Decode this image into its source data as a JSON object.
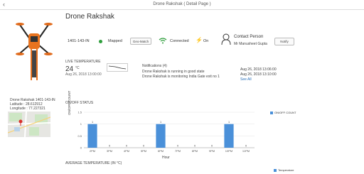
{
  "topbar": {
    "back_icon": "chevron-left-icon",
    "title": "Drone Rakshak ( Detail Page )"
  },
  "drone": {
    "name": "Drone Rakshak",
    "id": "1401-143-IN",
    "map_status": "Mapped",
    "map_status_color": "#2e9e3c",
    "geo_button": "Geo-Match",
    "wifi_status": "Connected",
    "power_status": "On",
    "contact_label": "Contact Person",
    "contact_name": "Mr Manusheet Gupta",
    "notify_button": "Notify"
  },
  "location": {
    "title": "Drone Rakshak 1401-143-IN",
    "latitude": "Latitude : 28.612912",
    "longitude": "Longitude : 77.227321"
  },
  "live_temperature": {
    "label": "LIVE TEMPERATURE",
    "value": "24",
    "unit": "°C",
    "timestamp": "Aug 26, 2018 13:00:00"
  },
  "notifications": {
    "title": "Notifications (4)",
    "items": [
      {
        "text": "Drone Rakshak is running in good state",
        "time": "Aug 26, 2018 13:06:00"
      },
      {
        "text": "Drone Rakshak is monitoring India Gate exit no 1",
        "time": "Aug 26, 2018 13:10:00"
      }
    ],
    "see_all": "See All"
  },
  "chart_data": {
    "type": "bar",
    "title": "ON/OFF STATUS",
    "xlabel": "Hour",
    "ylabel": "ON/OFF COUNT",
    "categories": [
      "2PM",
      "3PM",
      "4PM",
      "5PM",
      "6PM",
      "7PM",
      "8PM",
      "9PM",
      "10PM",
      "11PM"
    ],
    "series": [
      {
        "name": "ON/OFF COUNT",
        "values": [
          1,
          0,
          0,
          0,
          1,
          0,
          0,
          0,
          1,
          0
        ]
      }
    ],
    "ylim": [
      0,
      1.5
    ],
    "yticks": [
      "1.5",
      "1",
      "0.5",
      "0"
    ],
    "color": "#4a90d9",
    "legend": "top-right"
  },
  "avg_temperature": {
    "title": "AVERAGE TEMPERATURE (IN °C)",
    "legend": "Temperature"
  }
}
